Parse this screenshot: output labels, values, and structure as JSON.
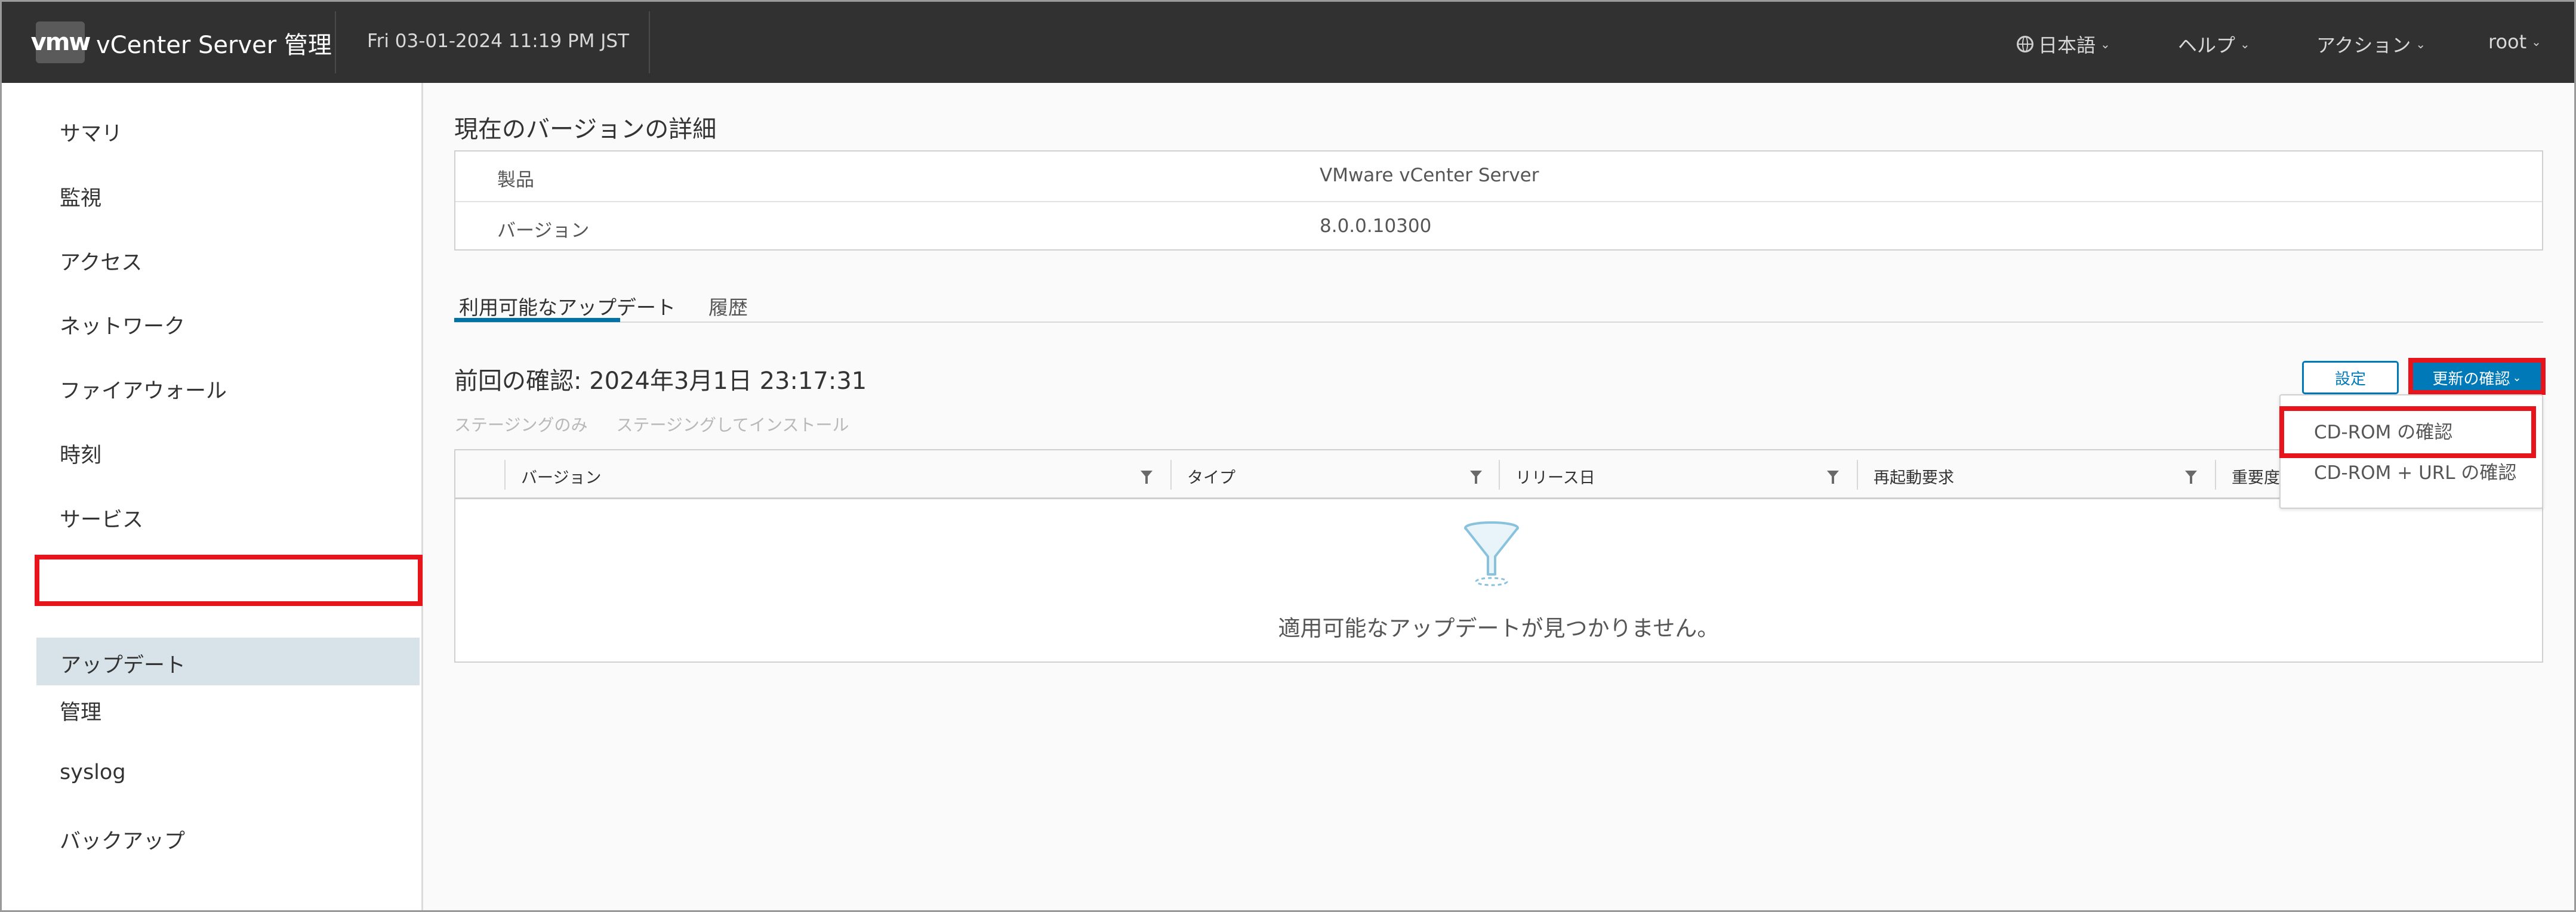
{
  "header": {
    "logo_text": "vmw",
    "app_title": "vCenter Server 管理",
    "datetime": "Fri 03-01-2024 11:19 PM JST",
    "language_label": "日本語",
    "help_label": "ヘルプ",
    "actions_label": "アクション",
    "user_label": "root",
    "chevron": "⌄"
  },
  "sidebar": {
    "items": [
      {
        "label": "サマリ"
      },
      {
        "label": "監視"
      },
      {
        "label": "アクセス"
      },
      {
        "label": "ネットワーク"
      },
      {
        "label": "ファイアウォール"
      },
      {
        "label": "時刻"
      },
      {
        "label": "サービス"
      },
      {
        "label": "アップデート",
        "active": true
      },
      {
        "label": "管理"
      },
      {
        "label": "syslog"
      },
      {
        "label": "バックアップ"
      }
    ]
  },
  "main": {
    "version_section_title": "現在のバージョンの詳細",
    "info": [
      {
        "key": "製品",
        "value": "VMware vCenter Server"
      },
      {
        "key": "バージョン",
        "value": "8.0.0.10300"
      }
    ],
    "tabs": [
      {
        "label": "利用可能なアップデート",
        "active": true
      },
      {
        "label": "履歴",
        "active": false
      }
    ],
    "last_check": "前回の確認: 2024年3月1日 23:17:31",
    "stage_only": "ステージングのみ",
    "stage_install": "ステージングしてインストール",
    "settings_button": "設定",
    "check_updates_button": "更新の確認",
    "columns": [
      "バージョン",
      "タイプ",
      "リリース日",
      "再起動要求",
      "重要度"
    ],
    "empty_message": "適用可能なアップデートが見つかりません。"
  },
  "dropdown": {
    "items": [
      {
        "label": "CD-ROM の確認"
      },
      {
        "label": "CD-ROM + URL の確認"
      }
    ]
  },
  "colors": {
    "header_bg": "#313131",
    "accent": "#0079b8",
    "highlight": "#e8141b",
    "sidebar_active": "#d8e3e9"
  }
}
